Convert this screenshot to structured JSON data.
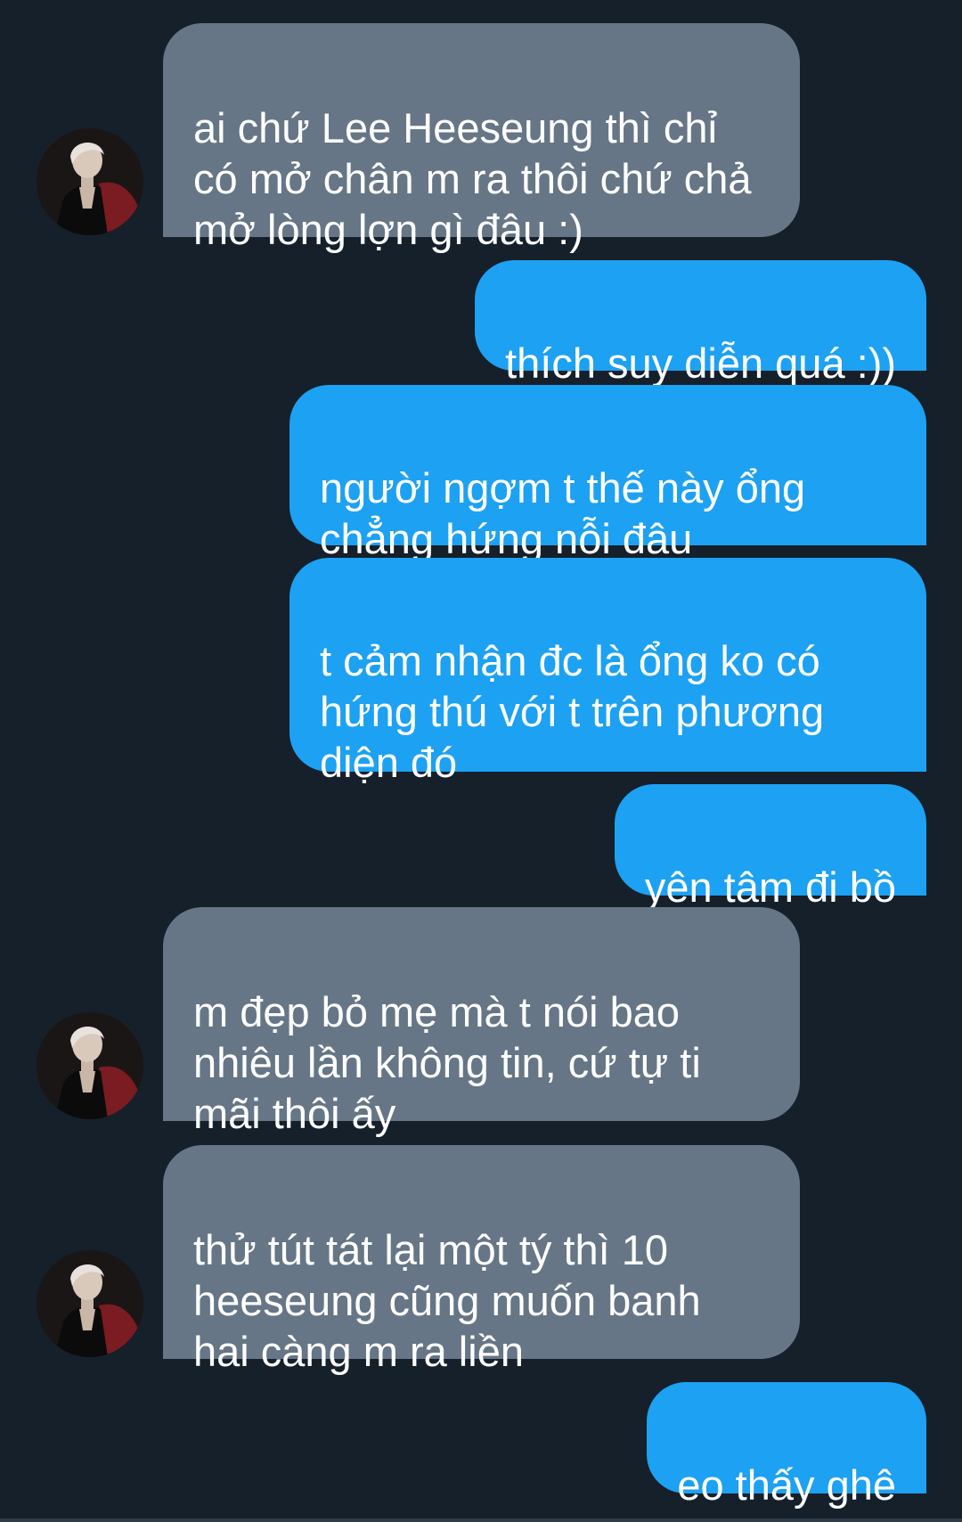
{
  "conversation": {
    "messages": [
      {
        "side": "in",
        "text": "ai chứ Lee Heeseung thì chỉ\ncó mở chân m ra thôi chứ chả\nmở lòng lợn gì đâu :)"
      },
      {
        "side": "out",
        "text": "thích suy diễn quá :))"
      },
      {
        "side": "out",
        "text": "người ngợm t thế này ổng\nchẳng hứng nỗi đâu"
      },
      {
        "side": "out",
        "text": "t cảm nhận đc là ổng ko có\nhứng thú với t trên phương\ndiện đó"
      },
      {
        "side": "out",
        "text": "yên tâm đi bồ"
      },
      {
        "side": "in",
        "text": "m đẹp bỏ mẹ mà t nói bao\nnhiêu lần không tin, cứ tự ti\nmãi thôi ấy"
      },
      {
        "side": "in",
        "text": "thử tút tát lại một tý thì 10\nheeseung cũng muốn banh\nhai càng m ra liền"
      },
      {
        "side": "out",
        "text": "eo thấy ghê"
      }
    ]
  },
  "colors": {
    "background": "#15202b",
    "incoming_bubble": "#667686",
    "outgoing_bubble": "#1da1f2",
    "text": "#ffffff"
  },
  "icons": {
    "avatar": "contact-avatar-photo"
  }
}
